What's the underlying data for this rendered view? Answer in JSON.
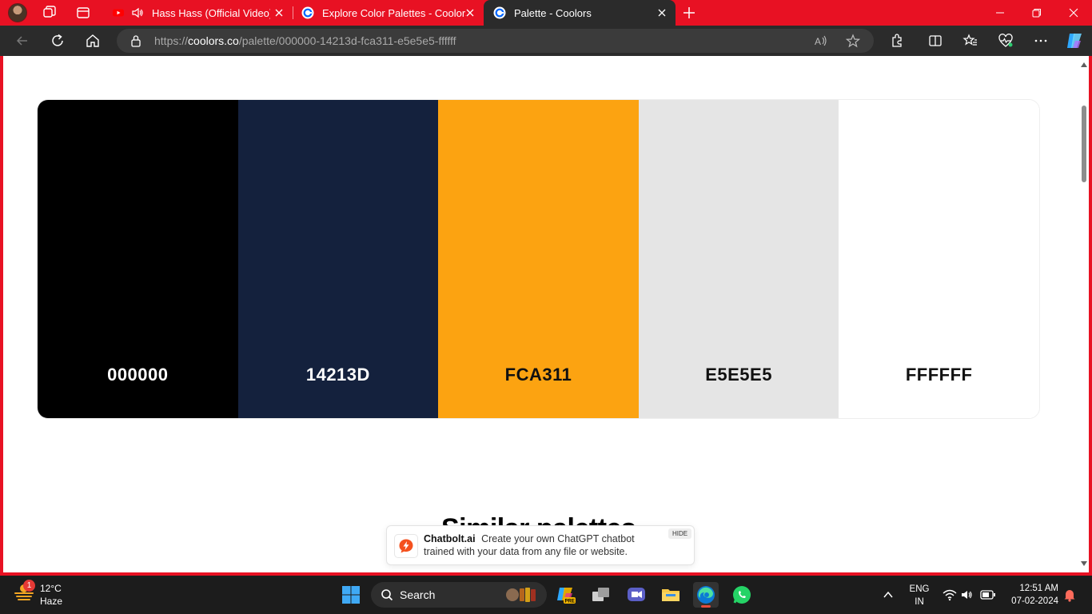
{
  "browser": {
    "tabs": [
      {
        "title": "Hass Hass (Official Video) D",
        "active": false,
        "muted": false
      },
      {
        "title": "Explore Color Palettes - Coolors",
        "active": false
      },
      {
        "title": "Palette - Coolors",
        "active": true
      }
    ],
    "url_prefix": "https://",
    "url_domain": "coolors.co",
    "url_path": "/palette/000000-14213d-fca311-e5e5e5-ffffff"
  },
  "page": {
    "palette": [
      {
        "hex": "000000",
        "color": "#000000",
        "text_color": "#ffffff"
      },
      {
        "hex": "14213D",
        "color": "#14213d",
        "text_color": "#ffffff"
      },
      {
        "hex": "FCA311",
        "color": "#fca311",
        "text_color": "#111111"
      },
      {
        "hex": "E5E5E5",
        "color": "#e5e5e5",
        "text_color": "#111111"
      },
      {
        "hex": "FFFFFF",
        "color": "#ffffff",
        "text_color": "#111111"
      }
    ],
    "similar_heading": "Similar palettes"
  },
  "ad": {
    "brand": "Chatbolt.ai",
    "text": "Create your own ChatGPT chatbot trained with your data from any file or website.",
    "hide_label": "HIDE"
  },
  "taskbar": {
    "weather_temp": "12°C",
    "weather_cond": "Haze",
    "weather_badge": "1",
    "search_label": "Search",
    "lang_top": "ENG",
    "lang_bottom": "IN",
    "time": "12:51 AM",
    "date": "07-02-2024"
  }
}
